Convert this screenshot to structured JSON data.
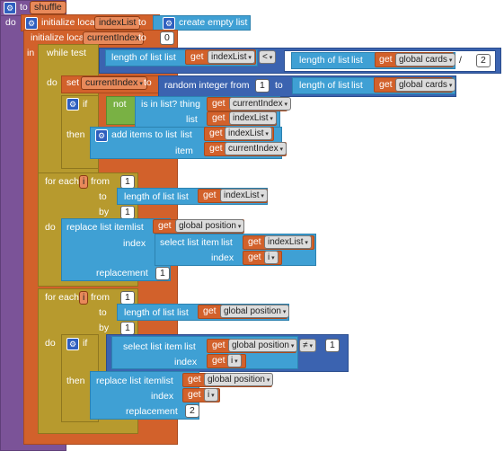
{
  "procedure": {
    "to": "to",
    "name": "shuffle",
    "do": "do"
  },
  "init1": {
    "label": "initialize local",
    "var": "indexList",
    "to": "to",
    "value": "create empty list"
  },
  "init2": {
    "label": "initialize local",
    "var": "currentIndex",
    "to": "to",
    "value": "0"
  },
  "in_label": "in",
  "while": {
    "label": "while",
    "test": "test",
    "do": "do"
  },
  "length_label": "length of list",
  "list_label": "list",
  "get": "get",
  "op_lt": "<",
  "op_div": "/",
  "op_neq": "≠",
  "vars": {
    "indexList": "indexList",
    "global_cards": "global cards",
    "currentIndex": "currentIndex",
    "global_position": "global position",
    "i": "i"
  },
  "numbers": {
    "two": "2",
    "one": "1"
  },
  "set": {
    "label": "set",
    "var": "currentIndex",
    "to": "to"
  },
  "random": {
    "label": "random integer from",
    "to": "to"
  },
  "if_block": {
    "if": "if",
    "then": "then"
  },
  "not_label": "not",
  "in_list": {
    "label": "is in list? thing",
    "list": "list"
  },
  "add_items": {
    "label": "add items to list",
    "list": "list",
    "item": "item"
  },
  "foreach": {
    "label": "for each",
    "from": "from",
    "to": "to",
    "by": "by",
    "do": "do"
  },
  "replace": {
    "label": "replace list item",
    "list": "list",
    "index": "index",
    "replacement": "replacement"
  },
  "select": {
    "label": "select list item",
    "list": "list",
    "index": "index"
  }
}
